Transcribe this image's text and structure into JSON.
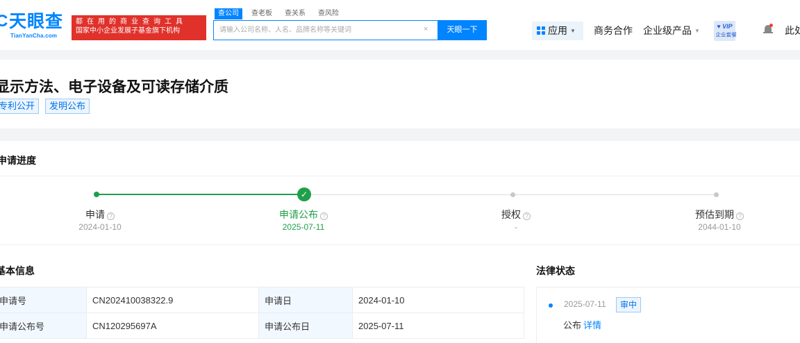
{
  "header": {
    "logo_text": "天眼查",
    "logo_sub": "TianYanCha.com",
    "slogan_line1": "都在用的商业查询工具",
    "slogan_line2": "国家中小企业发展子基金旗下机构",
    "search_tabs": [
      "查公司",
      "查老板",
      "查关系",
      "查风险"
    ],
    "search_placeholder": "请输入公司名称、人名、品牌名称等关键词",
    "search_clear": "×",
    "search_button": "天眼一下",
    "nav_apps": "应用",
    "nav_business": "商务合作",
    "nav_enterprise": "企业级产品",
    "vip_label": "VIP",
    "vip_sub": "企业套餐",
    "user": "此处"
  },
  "patent": {
    "title": "显示方法、电子设备及可读存储介质",
    "tags": [
      "专利公开",
      "发明公布"
    ]
  },
  "progress": {
    "section_title": "申请进度",
    "steps": [
      {
        "label": "申请",
        "date": "2024-01-10",
        "state": "done"
      },
      {
        "label": "申请公布",
        "date": "2025-07-11",
        "state": "current"
      },
      {
        "label": "授权",
        "date": "-",
        "state": "pending"
      },
      {
        "label": "预估到期",
        "date": "2044-01-10",
        "state": "pending"
      }
    ],
    "colors": {
      "done": "#1ea04a",
      "pending": "#c8c8c8"
    }
  },
  "basic_info": {
    "section_title": "基本信息",
    "rows": [
      {
        "k1": "申请号",
        "v1": "CN202410038322.9",
        "k2": "申请日",
        "v2": "2024-01-10"
      },
      {
        "k1": "申请公布号",
        "v1": "CN120295697A",
        "k2": "申请公布日",
        "v2": "2025-07-11"
      }
    ]
  },
  "legal_status": {
    "section_title": "法律状态",
    "date": "2025-07-11",
    "badge": "审中",
    "text": "公布",
    "link": "详情"
  }
}
